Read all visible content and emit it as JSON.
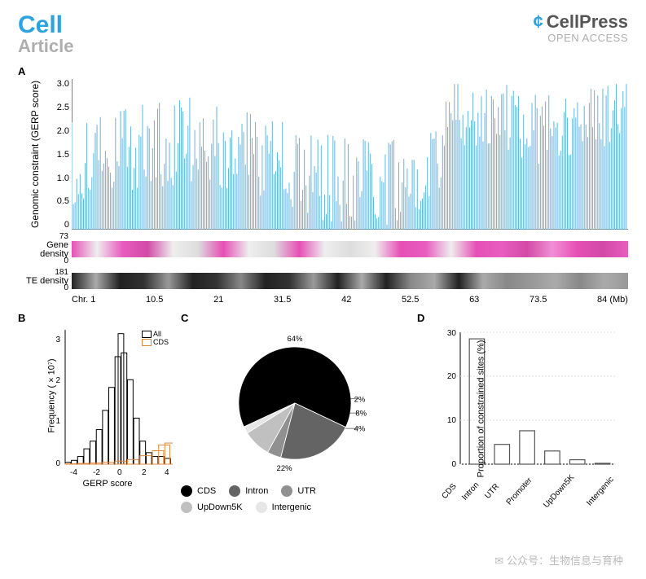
{
  "header": {
    "journal": "Cell",
    "article": "Article",
    "publisher": "CellPress",
    "access": "OPEN ACCESS"
  },
  "panels": {
    "A": "A",
    "B": "B",
    "C": "C",
    "D": "D"
  },
  "panelA": {
    "ylabel": "Genomic constraint\n(GERP score)",
    "yticks": [
      "3.0",
      "2.5",
      "2.0",
      "1.5",
      "1.0",
      "0.5",
      "0"
    ],
    "gene_label": "Gene\ndensity",
    "gene_max": "73",
    "gene_min": "0",
    "te_label": "TE\ndensity",
    "te_max": "181",
    "te_min": "0",
    "xticks": [
      "Chr. 1",
      "10.5",
      "21",
      "31.5",
      "42",
      "52.5",
      "63",
      "73.5",
      "84 (Mb)"
    ]
  },
  "panelB": {
    "ylabel": "Frequency ( × 10⁷)",
    "xlabel": "GERP score",
    "legend": {
      "all": "All",
      "cds": "CDS"
    },
    "xticks": [
      "-4",
      "-2",
      "0",
      "2",
      "4"
    ],
    "yticks": [
      "0",
      "1",
      "2",
      "3"
    ]
  },
  "panelC": {
    "slices": {
      "cds": {
        "label": "CDS",
        "pct": "64%",
        "color": "#000000"
      },
      "intron": {
        "label": "Intron",
        "pct": "22%",
        "color": "#646464"
      },
      "utr": {
        "label": "UTR",
        "pct": "4%",
        "color": "#909090"
      },
      "updown": {
        "label": "UpDown5K",
        "pct": "8%",
        "color": "#c0c0c0"
      },
      "intergenic": {
        "label": "Intergenic",
        "pct": "2%",
        "color": "#e6e6e6"
      }
    }
  },
  "panelD": {
    "ylabel": "Proportion of constrained sites (%)",
    "yticks": [
      "0",
      "10",
      "20",
      "30"
    ],
    "categories": [
      "CDS",
      "Intron",
      "UTR",
      "Promoter",
      "UpDown5K",
      "Intergenic"
    ]
  },
  "chart_data": [
    {
      "panel": "A",
      "type": "line_plus_heatmaps",
      "line": {
        "y": "GERP score per window along Chr. 1",
        "x_range_mb": [
          0,
          84
        ],
        "y_range": [
          0,
          3.0
        ],
        "note": "Dense jagged series; values mostly 0.2–2.5 with higher baseline (~2.0) after ~56 Mb"
      },
      "heatmaps": [
        {
          "track": "Gene density",
          "range": [
            0,
            73
          ],
          "colorscale": "white-to-magenta"
        },
        {
          "track": "TE density",
          "range": [
            0,
            181
          ],
          "colorscale": "white-to-black"
        }
      ],
      "xticks_mb": [
        0,
        10.5,
        21,
        31.5,
        42,
        52.5,
        63,
        73.5,
        84
      ]
    },
    {
      "panel": "B",
      "type": "histogram",
      "xlabel": "GERP score",
      "ylabel": "Frequency (×10^7)",
      "x_range": [
        -4,
        4
      ],
      "y_range": [
        0,
        3.5
      ],
      "series": [
        {
          "name": "All",
          "color": "#000000",
          "bins": [
            -4,
            -3.5,
            -3,
            -2.5,
            -2,
            -1.5,
            -1,
            -0.5,
            0,
            0.25,
            0.5,
            1,
            1.5,
            2,
            2.5,
            3,
            3.5,
            4
          ],
          "values": [
            0.05,
            0.1,
            0.2,
            0.4,
            0.6,
            0.9,
            1.4,
            2.0,
            2.8,
            3.4,
            2.9,
            2.2,
            1.2,
            0.6,
            0.3,
            0.2,
            0.2,
            0.15
          ]
        },
        {
          "name": "CDS",
          "color": "#e28a3c",
          "bins": [
            -4,
            -3,
            -2,
            -1,
            0,
            1,
            2,
            3,
            3.5,
            4
          ],
          "values": [
            0.01,
            0.02,
            0.03,
            0.05,
            0.08,
            0.12,
            0.22,
            0.35,
            0.5,
            0.55
          ]
        }
      ]
    },
    {
      "panel": "C",
      "type": "pie",
      "title": "",
      "slices": [
        {
          "label": "CDS",
          "value": 64,
          "color": "#000000"
        },
        {
          "label": "Intron",
          "value": 22,
          "color": "#646464"
        },
        {
          "label": "UTR",
          "value": 4,
          "color": "#909090"
        },
        {
          "label": "UpDown5K",
          "value": 8,
          "color": "#c0c0c0"
        },
        {
          "label": "Intergenic",
          "value": 2,
          "color": "#e6e6e6"
        }
      ]
    },
    {
      "panel": "D",
      "type": "bar",
      "ylabel": "Proportion of constrained sites (%)",
      "ylim": [
        0,
        30
      ],
      "categories": [
        "CDS",
        "Intron",
        "UTR",
        "Promoter",
        "UpDown5K",
        "Intergenic"
      ],
      "values": [
        28.5,
        4.5,
        7.6,
        3.0,
        1.0,
        0.2
      ]
    }
  ],
  "watermark": "公众号：生物信息与育种"
}
